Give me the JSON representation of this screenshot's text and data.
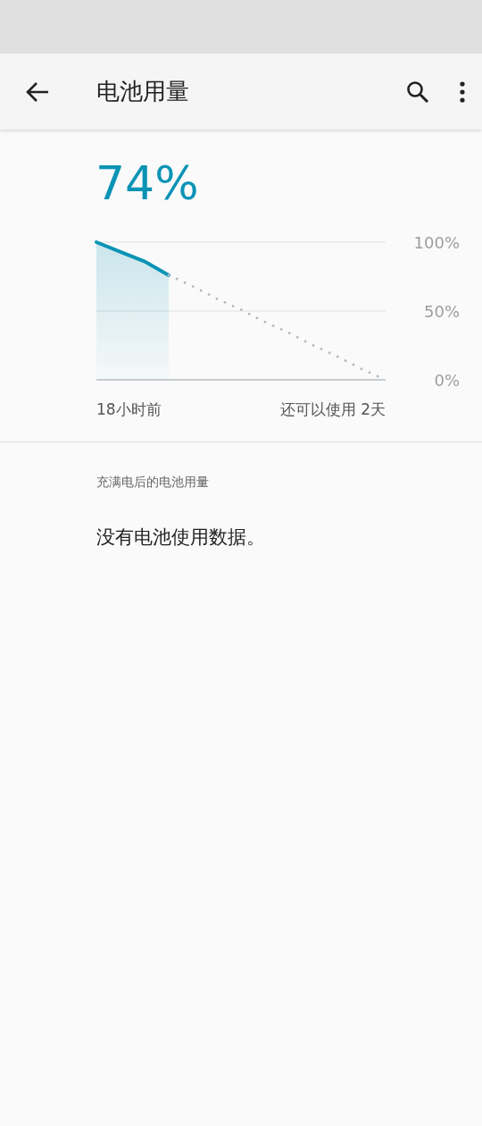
{
  "app_bar": {
    "title": "电池用量"
  },
  "battery": {
    "percent": "74%",
    "chart_data": {
      "type": "line",
      "categories": [
        null,
        null,
        null,
        null,
        null,
        null,
        null,
        null,
        null,
        null,
        null,
        null,
        null
      ],
      "ylim": [
        0,
        100
      ],
      "yticks": [
        {
          "value": 100,
          "label": "100%"
        },
        {
          "value": 50,
          "label": "50%"
        },
        {
          "value": 0,
          "label": "0%"
        }
      ],
      "series": [
        {
          "color": "#0a93b5",
          "line_style": "solid",
          "values": [
            100,
            93,
            86,
            76,
            null,
            null,
            null,
            null,
            null,
            null,
            null,
            null,
            null
          ]
        },
        {
          "color": "#b4bcc0",
          "line_style": "dotted",
          "values": [
            null,
            null,
            null,
            76,
            68,
            59,
            51,
            42,
            34,
            25,
            17,
            8,
            0
          ]
        }
      ]
    },
    "start_label": "18小时前",
    "end_label": "还可以使用 2天"
  },
  "section": {
    "header": "充满电后的电池用量",
    "message": "没有电池使用数据。"
  }
}
